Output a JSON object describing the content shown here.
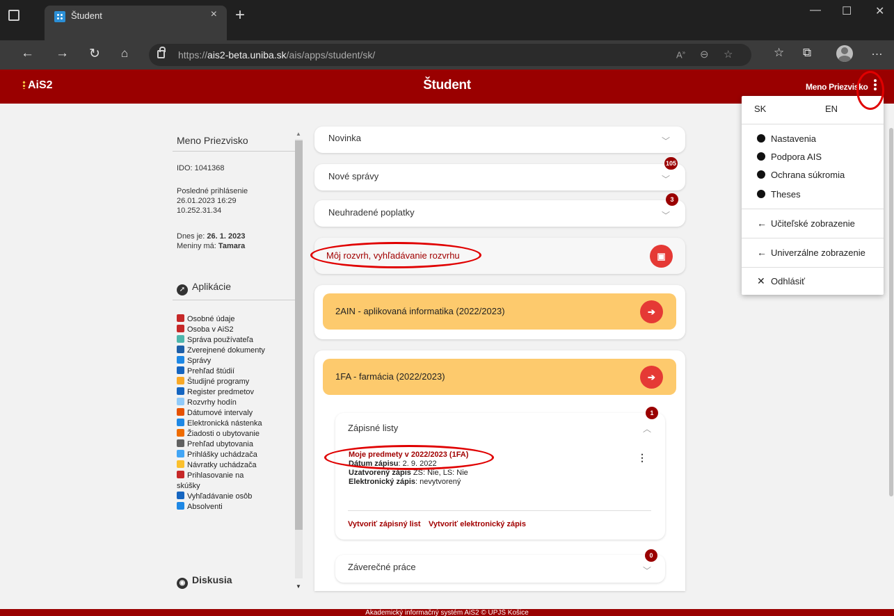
{
  "browser": {
    "tab_title": "Študent",
    "tab_close": "×",
    "new_tab": "+",
    "url_prefix": "https://",
    "url_host": "ais2-beta.uniba.sk",
    "url_path": "/ais/apps/student/sk/",
    "window_controls": [
      "—",
      "☐",
      "✕"
    ]
  },
  "header": {
    "logo_text": "AiS2",
    "title": "Študent",
    "user_name": "Meno Priezvisko"
  },
  "left_panel": {
    "name": "Meno Priezvisko",
    "ido": "IDO: 1041368",
    "last_login_label": "Posledné prihlásenie",
    "last_login_date": "26.01.2023 16:29",
    "last_login_ip": "10.252.31.34",
    "today_label": "Dnes je: ",
    "today_value": "26. 1. 2023",
    "nameday_label": "Meniny má: ",
    "nameday_value": "Tamara",
    "apps_heading": "Aplikácie",
    "apps": [
      {
        "label": "Osobné údaje",
        "icon": "person-icon",
        "color": "#c62828"
      },
      {
        "label": "Osoba v AiS2",
        "icon": "person-icon",
        "color": "#c62828"
      },
      {
        "label": "Správa používateľa",
        "icon": "users-icon",
        "color": "#4db6ac"
      },
      {
        "label": "Zverejnené dokumenty",
        "icon": "document-icon",
        "color": "#1e5fa8"
      },
      {
        "label": "Správy",
        "icon": "message-icon",
        "color": "#1e88e5"
      },
      {
        "label": "Prehľad štúdií",
        "icon": "studies-icon",
        "color": "#1565c0"
      },
      {
        "label": "Študijné programy",
        "icon": "programs-icon",
        "color": "#f9a825"
      },
      {
        "label": "Register predmetov",
        "icon": "register-icon",
        "color": "#1565c0"
      },
      {
        "label": "Rozvrhy hodín",
        "icon": "timetable-icon",
        "color": "#90caf9"
      },
      {
        "label": "Dátumové intervaly",
        "icon": "calendar-icon",
        "color": "#e65100"
      },
      {
        "label": "Elektronická nástenka",
        "icon": "board-icon",
        "color": "#1e88e5"
      },
      {
        "label": "Žiadosti o ubytovanie",
        "icon": "accommodation-icon",
        "color": "#ef6c00"
      },
      {
        "label": "Prehľad ubytovania",
        "icon": "grid-icon",
        "color": "#616161"
      },
      {
        "label": "Prihlášky uchádzača",
        "icon": "application-icon",
        "color": "#42a5f5"
      },
      {
        "label": "Návratky uchádzača",
        "icon": "return-icon",
        "color": "#fbc02d"
      },
      {
        "label": "Prihlasovanie na",
        "icon": "exam-icon",
        "color": "#c62828"
      },
      {
        "label": "skúšky",
        "icon": "",
        "color": ""
      },
      {
        "label": "Vyhľadávanie osôb",
        "icon": "search-persons-icon",
        "color": "#1565c0"
      },
      {
        "label": "Absolventi",
        "icon": "graduates-icon",
        "color": "#1e88e5"
      }
    ],
    "discussion_heading": "Diskusia"
  },
  "main": {
    "novinka": "Novinka",
    "nove_spravy": "Nové správy",
    "nove_spravy_badge": "105",
    "poplatky": "Neuhradené poplatky",
    "poplatky_badge": "3",
    "rozvrh": "Môj rozvrh, vyhľadávanie rozvrhu",
    "study1": "2AIN - aplikovaná informatika (2022/2023)",
    "study2": "1FA - farmácia (2022/2023)",
    "zapisne_listy": "Zápisné listy",
    "zapisne_badge": "1",
    "zl_title": "Moje predmety v 2022/2023 (1FA)",
    "zl_date_label": "Dátum zápisu",
    "zl_date_value": ": 2. 9. 2022",
    "zl_closed_label": "Uzatvorený zápis",
    "zl_closed_value": " ZS: Nie,  LS: Nie",
    "zl_electronic_label": "Elektronický zápis",
    "zl_electronic_value": ": nevytvorený",
    "btn_create_list": "Vytvoriť zápisný list",
    "btn_create_electronic": "Vytvoriť elektronický zápis",
    "zaverecne": "Záverečné práce",
    "zaverecne_badge": "0"
  },
  "menu": {
    "lang_sk": "SK",
    "lang_en": "EN",
    "items": [
      "Nastavenia",
      "Podpora AIS",
      "Ochrana súkromia",
      "Theses"
    ],
    "teacher_view": "Učiteľské zobrazenie",
    "universal_view": "Univerzálne zobrazenie",
    "logout": "Odhlásiť"
  },
  "footer": {
    "text": "Akademický informačný systém AiS2 © UPJŠ Košice"
  },
  "colors": {
    "brand_red": "#9a0000",
    "accent_red": "#e53935",
    "study_orange": "#fdca6d",
    "annotation_red": "#e00000"
  }
}
